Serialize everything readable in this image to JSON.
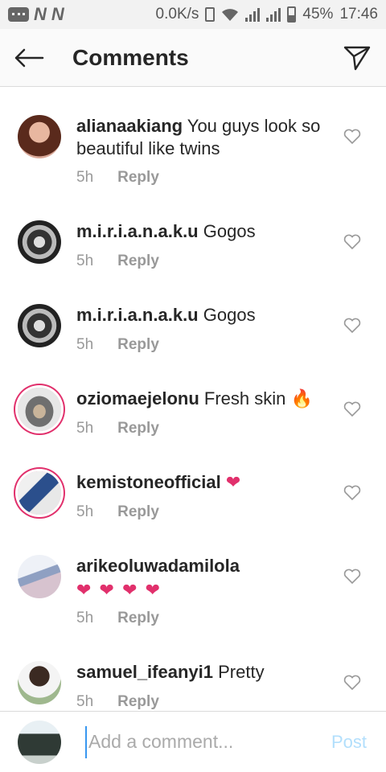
{
  "status_bar": {
    "network_speed": "0.0K/s",
    "n_label_1": "N",
    "n_label_2": "N",
    "battery": "45%",
    "time": "17:46"
  },
  "header": {
    "title": "Comments",
    "back_icon": "arrow-left-icon",
    "send_icon": "paper-plane-icon"
  },
  "comments": [
    {
      "username": "alianaakiang",
      "text": "You guys look so beautiful like twins",
      "time": "5h",
      "reply": "Reply"
    },
    {
      "username": "m.i.r.i.a.n.a.k.u",
      "text": "Gogos",
      "time": "5h",
      "reply": "Reply"
    },
    {
      "username": "m.i.r.i.a.n.a.k.u",
      "text": "Gogos",
      "time": "5h",
      "reply": "Reply"
    },
    {
      "username": "oziomaejelonu",
      "text": "Fresh skin",
      "emoji": "🔥",
      "time": "5h",
      "reply": "Reply"
    },
    {
      "username": "kemistoneofficial",
      "text": "",
      "emoji": "❤",
      "time": "5h",
      "reply": "Reply"
    },
    {
      "username": "arikeoluwadamilola",
      "text": "",
      "emoji": "❤ ❤ ❤ ❤",
      "time": "5h",
      "reply": "Reply"
    },
    {
      "username": "samuel_ifeanyi1",
      "text": "Pretty",
      "time": "5h",
      "reply": "Reply"
    }
  ],
  "composer": {
    "placeholder": "Add a comment...",
    "post_label": "Post"
  },
  "colors": {
    "accent": "#3897f0",
    "post_disabled": "#b2dffc",
    "story_ring": "#e1306c",
    "meta_grey": "#999999"
  }
}
